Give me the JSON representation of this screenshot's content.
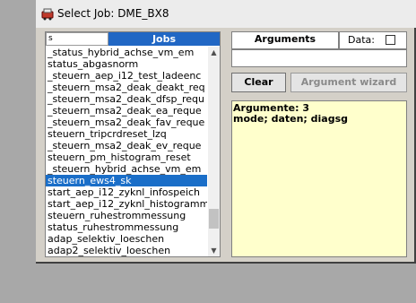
{
  "window": {
    "title": "Select Job: DME_BX8",
    "icon": "app-icon"
  },
  "jobs": {
    "filter_value": "s",
    "header": "Jobs",
    "items": [
      "_status_hybrid_achse_vm_em",
      "status_abgasnorm",
      "_steuern_aep_i12_test_ladeenc",
      "_steuern_msa2_deak_deakt_req",
      "_steuern_msa2_deak_dfsp_requ",
      "_steuern_msa2_deak_ea_reque",
      "_steuern_msa2_deak_fav_reque",
      "steuern_tripcrdreset_lzq",
      "_steuern_msa2_deak_ev_reque",
      "steuern_pm_histogram_reset",
      "_steuern_hybrid_achse_vm_em",
      "steuern_ews4_sk",
      "start_aep_i12_zyknl_infospeich",
      "start_aep_i12_zyknl_histogramm",
      "steuern_ruhestrommessung",
      "status_ruhestrommessung",
      "adap_selektiv_loeschen",
      "adap2_selektiv_loeschen"
    ],
    "selected_index": 11,
    "scroll_up_icon": "arrow-up-icon",
    "scroll_down_icon": "arrow-down-icon"
  },
  "arguments": {
    "header": "Arguments",
    "data_label": "Data:",
    "data_checked": false,
    "input_value": "",
    "clear_label": "Clear",
    "wizard_label": "Argument wizard",
    "result_lines": [
      "Argumente:  3",
      "mode; daten; diagsg"
    ]
  },
  "colors": {
    "selection": "#1a6ec8",
    "jobs_header": "#2167c4",
    "result_background": "#ffffcc",
    "window_background": "#d4d0c8"
  }
}
